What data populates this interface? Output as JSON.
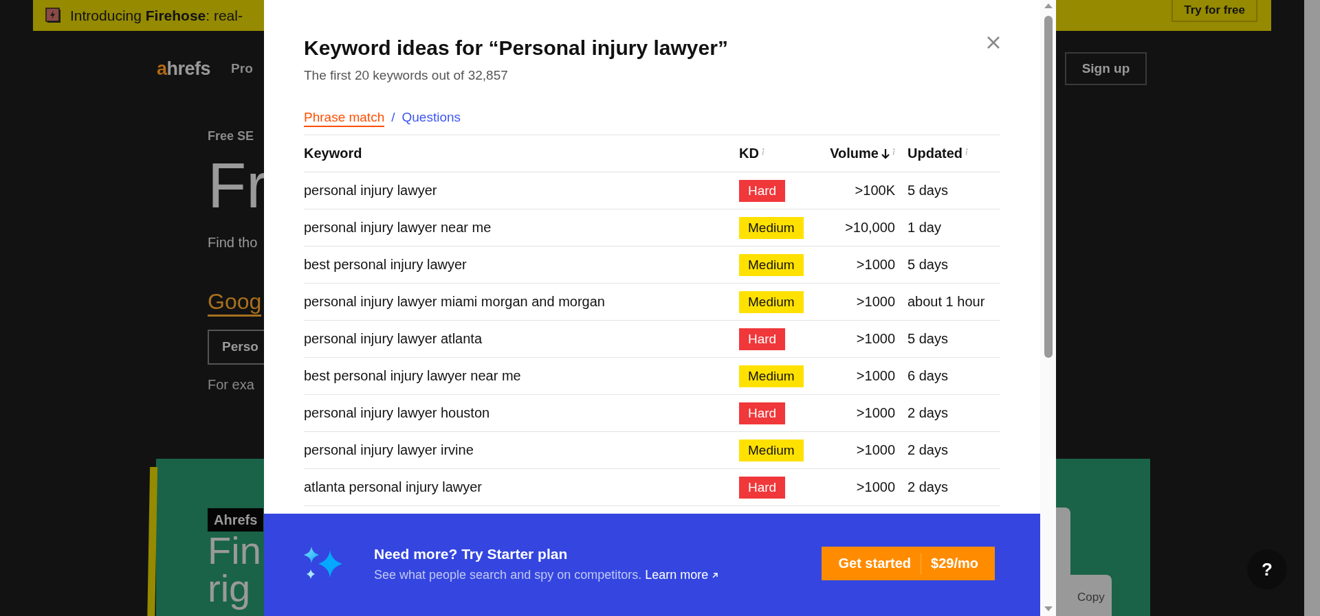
{
  "background_page": {
    "banner": {
      "text": "Introducing **Firehose**: real-",
      "button": "Try for free"
    },
    "nav": {
      "logo_accent": "a",
      "logo_rest": "hrefs",
      "link": "Pro",
      "signup": "Sign up"
    },
    "hero": {
      "eyebrow": "Free SE",
      "heading": "Fr",
      "lead": "Find tho",
      "engine_link": "Goog",
      "search_value": "Perso",
      "example": "For exa"
    },
    "card": {
      "tag": "Ahrefs",
      "heading_lines": [
        "Fin",
        "rig"
      ],
      "widget_label": "Copy"
    },
    "help_button": "?"
  },
  "modal": {
    "title": "Keyword ideas for “Personal injury lawyer”",
    "subtitle": "The first 20 keywords out of 32,857",
    "tabs": [
      {
        "label": "Phrase match",
        "selected": true
      },
      {
        "label": "Questions",
        "selected": false
      }
    ],
    "tab_separator": "/",
    "table": {
      "columns": [
        {
          "label": "Keyword",
          "info": false,
          "sorted": false
        },
        {
          "label": "KD",
          "info": true,
          "sorted": false
        },
        {
          "label": "Volume",
          "info": true,
          "sorted": true
        },
        {
          "label": "Updated",
          "info": true,
          "sorted": false
        }
      ],
      "rows": [
        {
          "keyword": "personal injury lawyer",
          "kd": {
            "label": "Hard",
            "kind": "hard"
          },
          "volume": ">100K",
          "updated": "5 days"
        },
        {
          "keyword": "personal injury lawyer near me",
          "kd": {
            "label": "Medium",
            "kind": "medium"
          },
          "volume": ">10,000",
          "updated": "1 day"
        },
        {
          "keyword": "best personal injury lawyer",
          "kd": {
            "label": "Medium",
            "kind": "medium"
          },
          "volume": ">1000",
          "updated": "5 days"
        },
        {
          "keyword": "personal injury lawyer miami morgan and morgan",
          "kd": {
            "label": "Medium",
            "kind": "medium"
          },
          "volume": ">1000",
          "updated": "about 1 hour"
        },
        {
          "keyword": "personal injury lawyer atlanta",
          "kd": {
            "label": "Hard",
            "kind": "hard"
          },
          "volume": ">1000",
          "updated": "5 days"
        },
        {
          "keyword": "best personal injury lawyer near me",
          "kd": {
            "label": "Medium",
            "kind": "medium"
          },
          "volume": ">1000",
          "updated": "6 days"
        },
        {
          "keyword": "personal injury lawyer houston",
          "kd": {
            "label": "Hard",
            "kind": "hard"
          },
          "volume": ">1000",
          "updated": "2 days"
        },
        {
          "keyword": "personal injury lawyer irvine",
          "kd": {
            "label": "Medium",
            "kind": "medium"
          },
          "volume": ">1000",
          "updated": "2 days"
        },
        {
          "keyword": "atlanta personal injury lawyer",
          "kd": {
            "label": "Hard",
            "kind": "hard"
          },
          "volume": ">1000",
          "updated": "2 days"
        }
      ]
    },
    "promo": {
      "heading": "Need more? Try Starter plan",
      "text": "See what people search and spy on competitors.",
      "link": "Learn more",
      "button": {
        "label": "Get started",
        "price": "$29/mo"
      }
    }
  }
}
